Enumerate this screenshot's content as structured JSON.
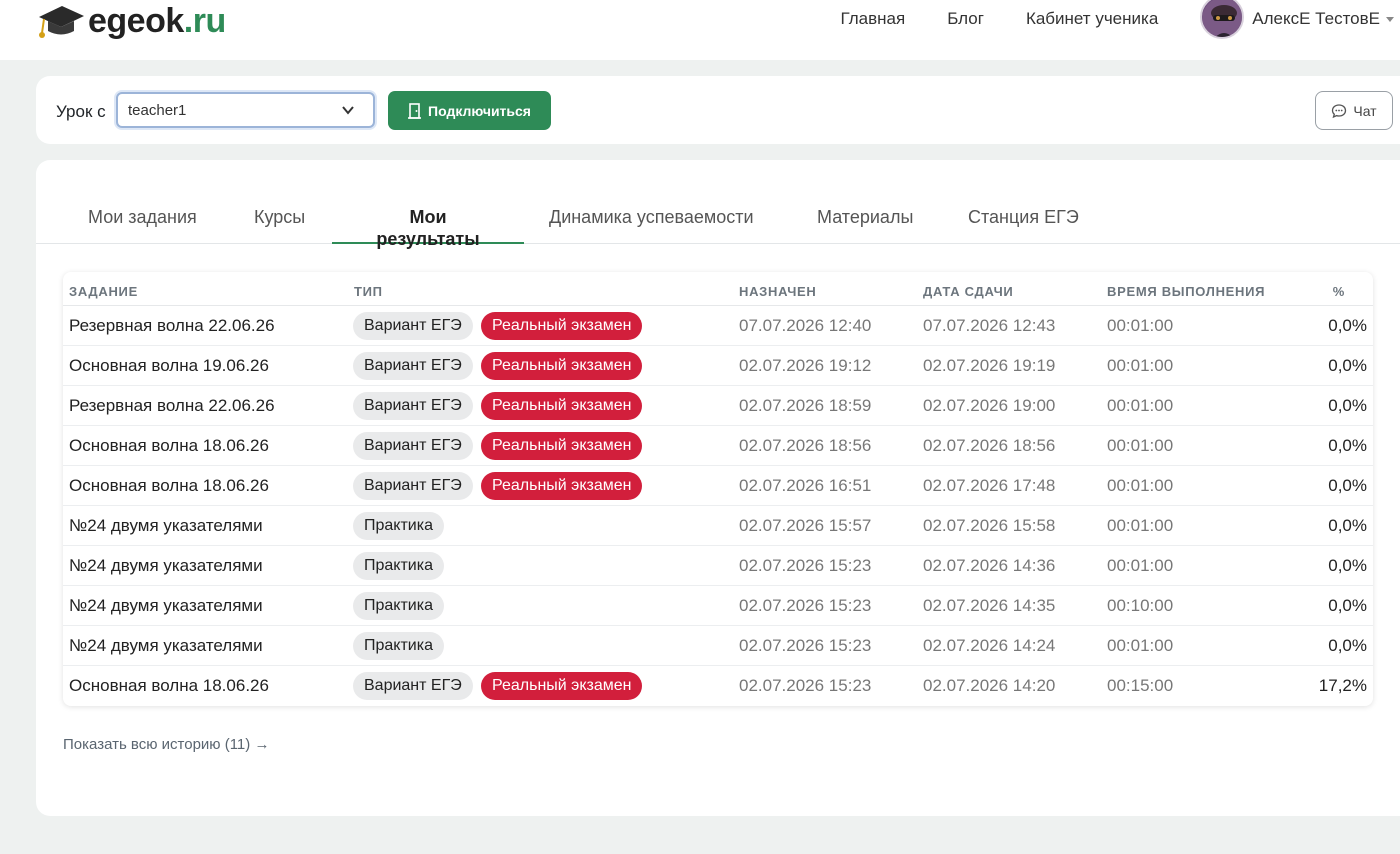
{
  "header": {
    "logo_main": "egeok",
    "logo_tld": ".ru",
    "nav": [
      "Главная",
      "Блог",
      "Кабинет ученика"
    ],
    "user_name": "АлексЕ ТестовЕ"
  },
  "lesson": {
    "label": "Урок с",
    "teacher_value": "teacher1",
    "connect_label": "Подключиться",
    "chat_label": "Чат"
  },
  "tabs": [
    {
      "label": "Мои задания",
      "active": false
    },
    {
      "label": "Курсы",
      "active": false
    },
    {
      "label": "Мои результаты",
      "active": true
    },
    {
      "label": "Динамика успеваемости",
      "active": false
    },
    {
      "label": "Материалы",
      "active": false
    },
    {
      "label": "Станция ЕГЭ",
      "active": false
    }
  ],
  "table": {
    "headers": {
      "task": "ЗАДАНИЕ",
      "type": "ТИП",
      "assigned": "НАЗНАЧЕН",
      "submitted": "ДАТА СДАЧИ",
      "duration": "ВРЕМЯ ВЫПОЛНЕНИЯ",
      "percent": "%"
    },
    "rows": [
      {
        "task": "Резервная волна 22.06.26",
        "badges": [
          "Вариант ЕГЭ",
          "Реальный экзамен"
        ],
        "assigned": "07.07.2026 12:40",
        "submitted": "07.07.2026 12:43",
        "duration": "00:01:00",
        "percent": "0,0%"
      },
      {
        "task": "Основная волна 19.06.26",
        "badges": [
          "Вариант ЕГЭ",
          "Реальный экзамен"
        ],
        "assigned": "02.07.2026 19:12",
        "submitted": "02.07.2026 19:19",
        "duration": "00:01:00",
        "percent": "0,0%"
      },
      {
        "task": "Резервная волна 22.06.26",
        "badges": [
          "Вариант ЕГЭ",
          "Реальный экзамен"
        ],
        "assigned": "02.07.2026 18:59",
        "submitted": "02.07.2026 19:00",
        "duration": "00:01:00",
        "percent": "0,0%"
      },
      {
        "task": "Основная волна 18.06.26",
        "badges": [
          "Вариант ЕГЭ",
          "Реальный экзамен"
        ],
        "assigned": "02.07.2026 18:56",
        "submitted": "02.07.2026 18:56",
        "duration": "00:01:00",
        "percent": "0,0%"
      },
      {
        "task": "Основная волна 18.06.26",
        "badges": [
          "Вариант ЕГЭ",
          "Реальный экзамен"
        ],
        "assigned": "02.07.2026 16:51",
        "submitted": "02.07.2026 17:48",
        "duration": "00:01:00",
        "percent": "0,0%"
      },
      {
        "task": "№24 двумя указателями",
        "badges": [
          "Практика"
        ],
        "assigned": "02.07.2026 15:57",
        "submitted": "02.07.2026 15:58",
        "duration": "00:01:00",
        "percent": "0,0%"
      },
      {
        "task": "№24 двумя указателями",
        "badges": [
          "Практика"
        ],
        "assigned": "02.07.2026 15:23",
        "submitted": "02.07.2026 14:36",
        "duration": "00:01:00",
        "percent": "0,0%"
      },
      {
        "task": "№24 двумя указателями",
        "badges": [
          "Практика"
        ],
        "assigned": "02.07.2026 15:23",
        "submitted": "02.07.2026 14:35",
        "duration": "00:10:00",
        "percent": "0,0%"
      },
      {
        "task": "№24 двумя указателями",
        "badges": [
          "Практика"
        ],
        "assigned": "02.07.2026 15:23",
        "submitted": "02.07.2026 14:24",
        "duration": "00:01:00",
        "percent": "0,0%"
      },
      {
        "task": "Основная волна 18.06.26",
        "badges": [
          "Вариант ЕГЭ",
          "Реальный экзамен"
        ],
        "assigned": "02.07.2026 15:23",
        "submitted": "02.07.2026 14:20",
        "duration": "00:15:00",
        "percent": "17,2%"
      }
    ]
  },
  "history_link": "Показать всю историю (11) →",
  "colors": {
    "accent": "#2e8b57",
    "exam_badge": "#d21f3c",
    "practice_badge": "#e9eaeb"
  }
}
